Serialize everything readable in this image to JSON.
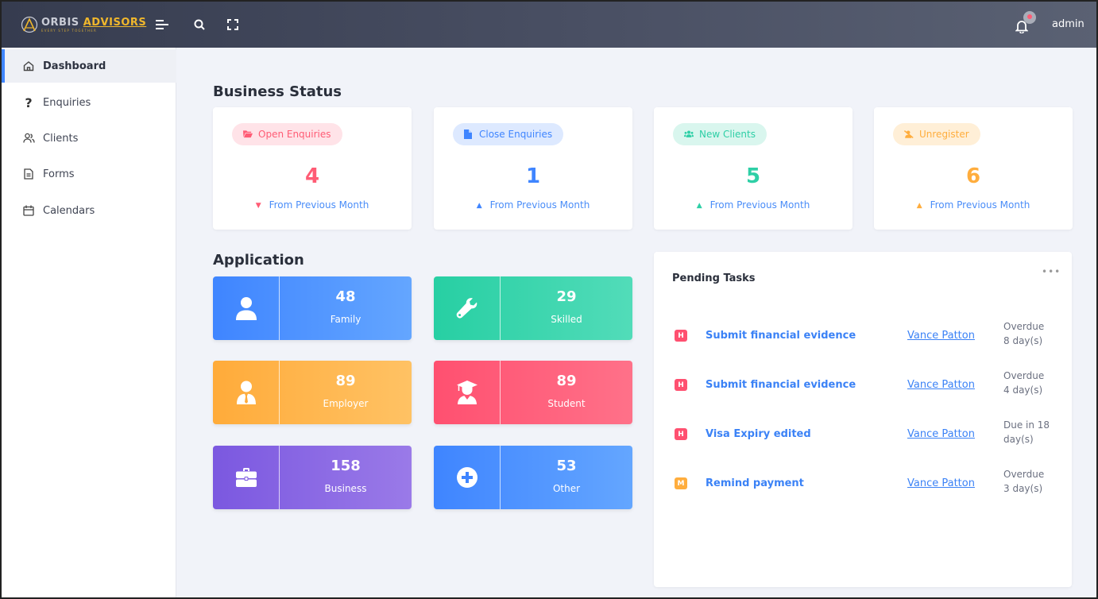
{
  "brand": {
    "logo_gray": "ORBIS",
    "logo_gold": "ADVISORS",
    "tagline": "EVERY STEP TOGETHER"
  },
  "topbar": {
    "user": "admin"
  },
  "sidebar": {
    "items": [
      {
        "label": "Dashboard",
        "icon": "home-icon",
        "active": true
      },
      {
        "label": "Enquiries",
        "icon": "question-icon"
      },
      {
        "label": "Clients",
        "icon": "users-icon"
      },
      {
        "label": "Forms",
        "icon": "document-icon"
      },
      {
        "label": "Calendars",
        "icon": "calendar-icon"
      }
    ]
  },
  "business_status": {
    "title": "Business Status",
    "cards": [
      {
        "label": "Open Enquiries",
        "value": "4",
        "trend": "down",
        "sub": "From Previous Month",
        "color": "#ff5c75",
        "pill_bg": "#ffe3e8",
        "icon": "folder-open-icon"
      },
      {
        "label": "Close Enquiries",
        "value": "1",
        "trend": "up",
        "sub": "From Previous Month",
        "color": "#3f85ff",
        "pill_bg": "#dde9ff",
        "icon": "file-icon"
      },
      {
        "label": "New Clients",
        "value": "5",
        "trend": "up",
        "sub": "From Previous Month",
        "color": "#2ecfa6",
        "pill_bg": "#d9f6ee",
        "icon": "users-icon"
      },
      {
        "label": "Unregister",
        "value": "6",
        "trend": "up",
        "sub": "From Previous Month",
        "color": "#ffad3d",
        "pill_bg": "#ffefd7",
        "icon": "user-slash-icon"
      }
    ]
  },
  "application": {
    "title": "Application",
    "cards": [
      {
        "label": "Family",
        "value": "48",
        "icon": "user-icon",
        "colors": [
          "#3f85ff",
          "#64a6ff"
        ]
      },
      {
        "label": "Skilled",
        "value": "29",
        "icon": "wrench-icon",
        "colors": [
          "#27cfa3",
          "#52dcb9"
        ]
      },
      {
        "label": "Employer",
        "value": "89",
        "icon": "user-tie-icon",
        "colors": [
          "#ffab3a",
          "#ffc264"
        ]
      },
      {
        "label": "Student",
        "value": "89",
        "icon": "graduate-icon",
        "colors": [
          "#ff5070",
          "#ff7189"
        ]
      },
      {
        "label": "Business",
        "value": "158",
        "icon": "briefcase-icon",
        "colors": [
          "#7b58e0",
          "#9a7ae8"
        ]
      },
      {
        "label": "Other",
        "value": "53",
        "icon": "plus-circle-icon",
        "colors": [
          "#3f85ff",
          "#64a6ff"
        ]
      }
    ]
  },
  "pending_tasks": {
    "title": "Pending Tasks",
    "more": "•••",
    "tasks": [
      {
        "priority": "H",
        "name": "Submit financial evidence",
        "owner": "Vance Patton",
        "due_line1": "Overdue",
        "due_line2": "8 day(s)",
        "color": "#ff5070"
      },
      {
        "priority": "H",
        "name": "Submit financial evidence",
        "owner": "Vance Patton",
        "due_line1": "Overdue",
        "due_line2": "4 day(s)",
        "color": "#ff5070"
      },
      {
        "priority": "H",
        "name": "Visa Expiry edited",
        "owner": "Vance Patton",
        "due_line1": "Due in 18",
        "due_line2": "day(s)",
        "color": "#ff5070"
      },
      {
        "priority": "M",
        "name": "Remind payment",
        "owner": "Vance Patton",
        "due_line1": "Overdue",
        "due_line2": "3 day(s)",
        "color": "#ffad3d"
      }
    ]
  }
}
